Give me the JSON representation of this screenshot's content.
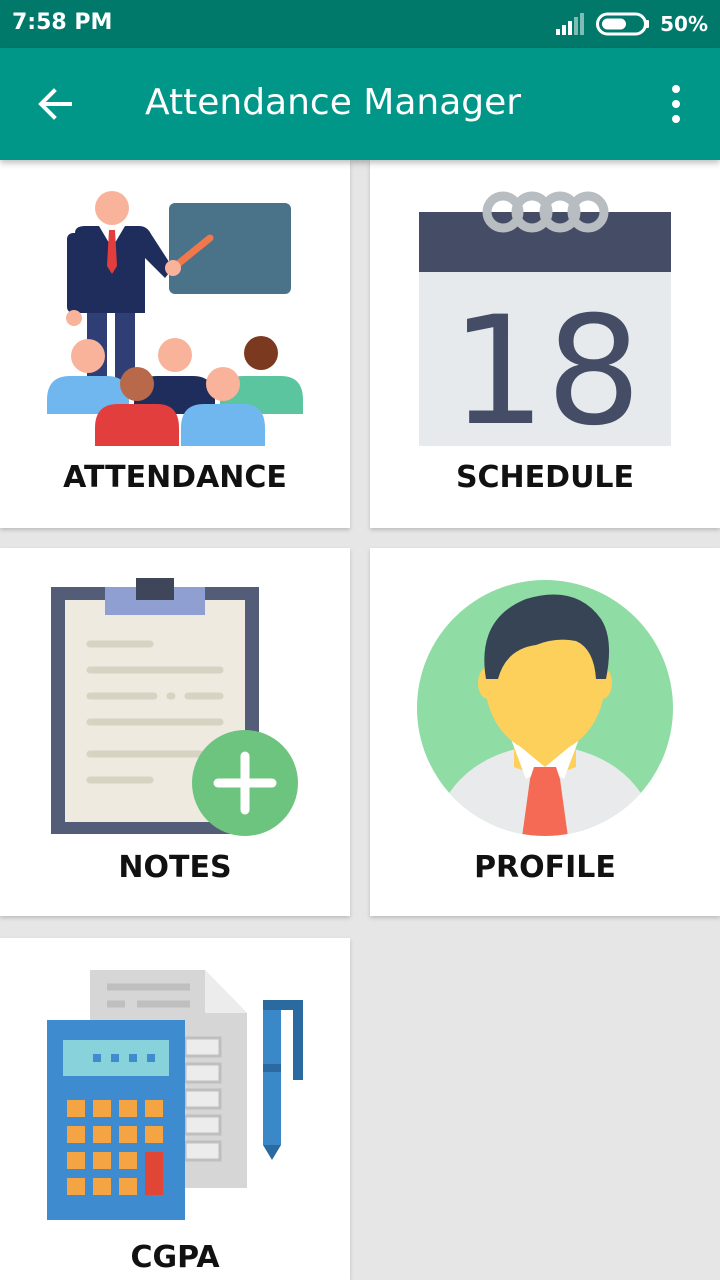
{
  "status_bar": {
    "time": "7:58 PM",
    "battery": "50%",
    "signal_icon": "signal-icon",
    "battery_icon": "battery-icon"
  },
  "app_bar": {
    "title": "Attendance Manager",
    "back_icon": "arrow-left-icon",
    "menu_icon": "more-vert-icon"
  },
  "menu": [
    {
      "label": "ATTENDANCE",
      "icon": "classroom-illustration"
    },
    {
      "label": "SCHEDULE",
      "icon": "calendar-illustration",
      "calendar_day": "18"
    },
    {
      "label": "NOTES",
      "icon": "clipboard-add-illustration"
    },
    {
      "label": "PROFILE",
      "icon": "avatar-illustration"
    },
    {
      "label": "CGPA",
      "icon": "calculator-illustration"
    }
  ],
  "colors": {
    "status_bar": "#00796b",
    "app_bar": "#009688",
    "background": "#e6e6e6",
    "card": "#ffffff"
  }
}
